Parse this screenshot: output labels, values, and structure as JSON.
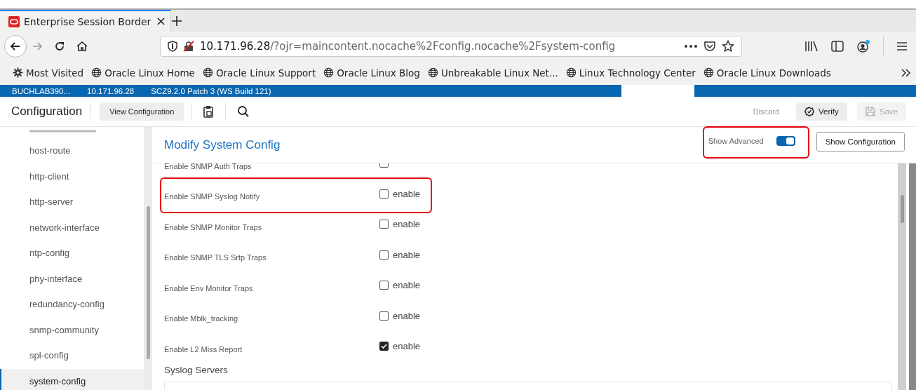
{
  "browser": {
    "tabs": [
      {
        "title": "Enterprise Session Border",
        "selected": true
      }
    ],
    "url": {
      "host": "10.171.96.28",
      "path": "/?ojr=maincontent.nocache%2Fconfig.nocache%2Fsystem-config"
    },
    "bookmarks": [
      {
        "label": "Most Visited",
        "kind": "gear"
      },
      {
        "label": "Oracle Linux Home",
        "kind": "globe"
      },
      {
        "label": "Oracle Linux Support",
        "kind": "globe"
      },
      {
        "label": "Oracle Linux Blog",
        "kind": "globe"
      },
      {
        "label": "Unbreakable Linux Net...",
        "kind": "globe"
      },
      {
        "label": "Linux Technology Center",
        "kind": "globe"
      },
      {
        "label": "Oracle Linux Downloads",
        "kind": "globe"
      }
    ]
  },
  "banner": {
    "hostname": "BUCHLAB390...",
    "address": "10.171.96.28",
    "version": "SCZ9.2.0 Patch 3 (WS Build 121)"
  },
  "toolbar": {
    "title": "Configuration",
    "view_button": "View Configuration",
    "discard": "Discard",
    "verify": "Verify",
    "save": "Save",
    "save_disabled": true
  },
  "sidebar": {
    "items": [
      {
        "label": "host-route",
        "selected": false
      },
      {
        "label": "http-client",
        "selected": false
      },
      {
        "label": "http-server",
        "selected": false
      },
      {
        "label": "network-interface",
        "selected": false
      },
      {
        "label": "ntp-config",
        "selected": false
      },
      {
        "label": "phy-interface",
        "selected": false
      },
      {
        "label": "redundancy-config",
        "selected": false
      },
      {
        "label": "snmp-community",
        "selected": false
      },
      {
        "label": "spl-config",
        "selected": false
      },
      {
        "label": "system-config",
        "selected": true
      }
    ]
  },
  "panel": {
    "title": "Modify System Config",
    "show_advanced": {
      "label": "Show Advanced",
      "on": true,
      "highlighted": true
    },
    "show_config_button": "Show Configuration",
    "fields": [
      {
        "label": "Enable SNMP Auth Traps",
        "checked": false,
        "highlighted": false
      },
      {
        "label": "Enable SNMP Syslog Notify",
        "option": "enable",
        "checked": false,
        "highlighted": true
      },
      {
        "label": "Enable SNMP Monitor Traps",
        "option": "enable",
        "checked": false,
        "highlighted": false
      },
      {
        "label": "Enable SNMP TLS Srtp Traps",
        "option": "enable",
        "checked": false,
        "highlighted": false
      },
      {
        "label": "Enable Env Monitor Traps",
        "option": "enable",
        "checked": false,
        "highlighted": false
      },
      {
        "label": "Enable Mblk_tracking",
        "option": "enable",
        "checked": false,
        "highlighted": false
      },
      {
        "label": "Enable L2 Miss Report",
        "option": "enable",
        "checked": true,
        "highlighted": false
      }
    ],
    "section": "Syslog Servers"
  }
}
